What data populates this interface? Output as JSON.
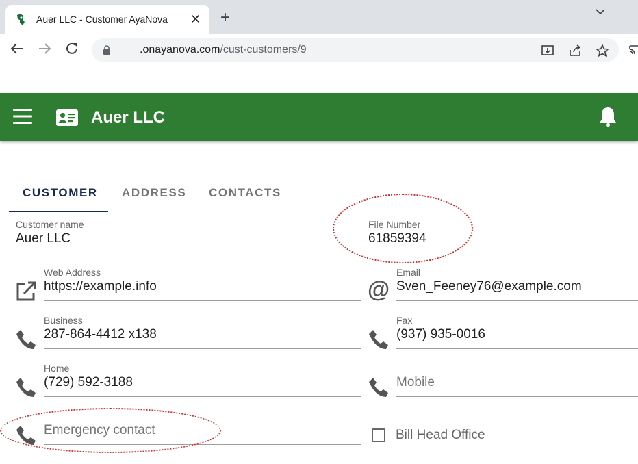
{
  "browser": {
    "tab_title": "Auer LLC - Customer AyaNova",
    "tab_close": "✕",
    "new_tab": "+",
    "url_host": ".onayanova.com",
    "url_path": "/cust-customers/9"
  },
  "appbar": {
    "title": "Auer LLC",
    "color": "#2e7d32"
  },
  "tabs": [
    {
      "label": "CUSTOMER",
      "active": true
    },
    {
      "label": "ADDRESS",
      "active": false
    },
    {
      "label": "CONTACTS",
      "active": false
    }
  ],
  "form": {
    "customer_name": {
      "label": "Customer name",
      "value": "Auer LLC"
    },
    "file_number": {
      "label": "File Number",
      "value": "61859394"
    },
    "web_address": {
      "label": "Web Address",
      "value": "https://example.info",
      "icon": "open-in-new-icon"
    },
    "email": {
      "label": "Email",
      "value": "Sven_Feeney76@example.com",
      "icon": "at-icon"
    },
    "business": {
      "label": "Business",
      "value": "287-864-4412 x138",
      "icon": "phone-icon"
    },
    "fax": {
      "label": "Fax",
      "value": "(937) 935-0016",
      "icon": "phone-icon"
    },
    "home": {
      "label": "Home",
      "value": "(729) 592-3188",
      "icon": "phone-icon"
    },
    "mobile": {
      "placeholder": "Mobile",
      "icon": "phone-icon"
    },
    "emergency": {
      "placeholder": "Emergency contact",
      "icon": "phone-icon"
    },
    "bill_head_office": {
      "label": "Bill Head Office",
      "checked": false
    }
  }
}
